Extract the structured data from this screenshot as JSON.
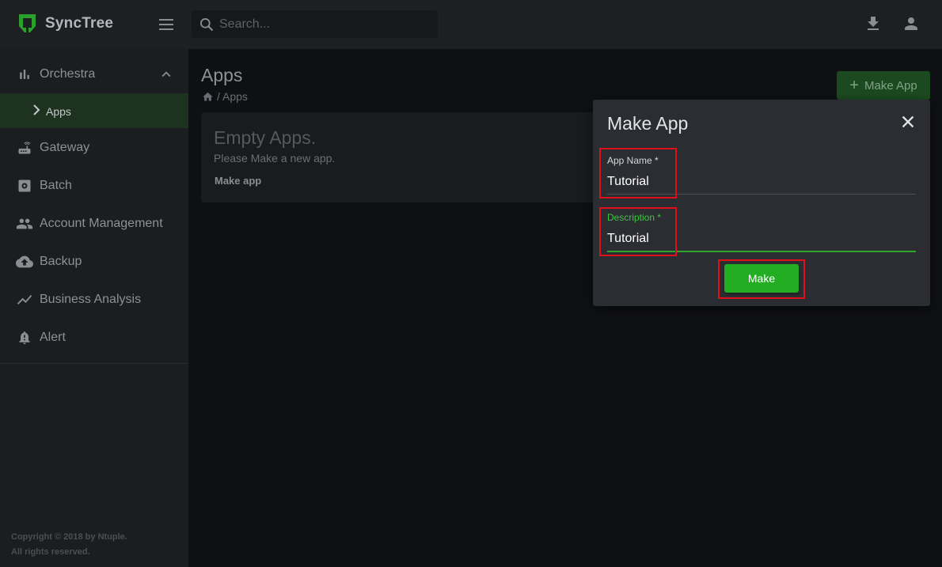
{
  "app": {
    "name": "SyncTree"
  },
  "search": {
    "placeholder": "Search..."
  },
  "sidebar": {
    "items": [
      {
        "label": "Orchestra",
        "icon": "bar-chart-icon"
      },
      {
        "label": "Gateway",
        "icon": "router-icon"
      },
      {
        "label": "Batch",
        "icon": "gear-box-icon"
      },
      {
        "label": "Account Management",
        "icon": "people-icon"
      },
      {
        "label": "Backup",
        "icon": "cloud-upload-icon"
      },
      {
        "label": "Business Analysis",
        "icon": "trend-line-icon"
      },
      {
        "label": "Alert",
        "icon": "bell-icon"
      }
    ],
    "sub_items": [
      {
        "label": "Apps"
      }
    ],
    "copyright_line1": "Copyright © 2018 by Ntuple.",
    "copyright_line2": "All rights reserved."
  },
  "main": {
    "title": "Apps",
    "breadcrumb": "/ Apps",
    "make_app_button": "Make App",
    "empty_card": {
      "title": "Empty Apps.",
      "subtitle": "Please Make a new app.",
      "link": "Make app"
    }
  },
  "dialog": {
    "title": "Make App",
    "app_name_label": "App Name *",
    "app_name_value": "Tutorial",
    "description_label": "Description *",
    "description_value": "Tutorial",
    "make_button": "Make"
  },
  "colors": {
    "accent": "#22ad22",
    "highlight": "#e0101b",
    "background": "#0f1013"
  }
}
